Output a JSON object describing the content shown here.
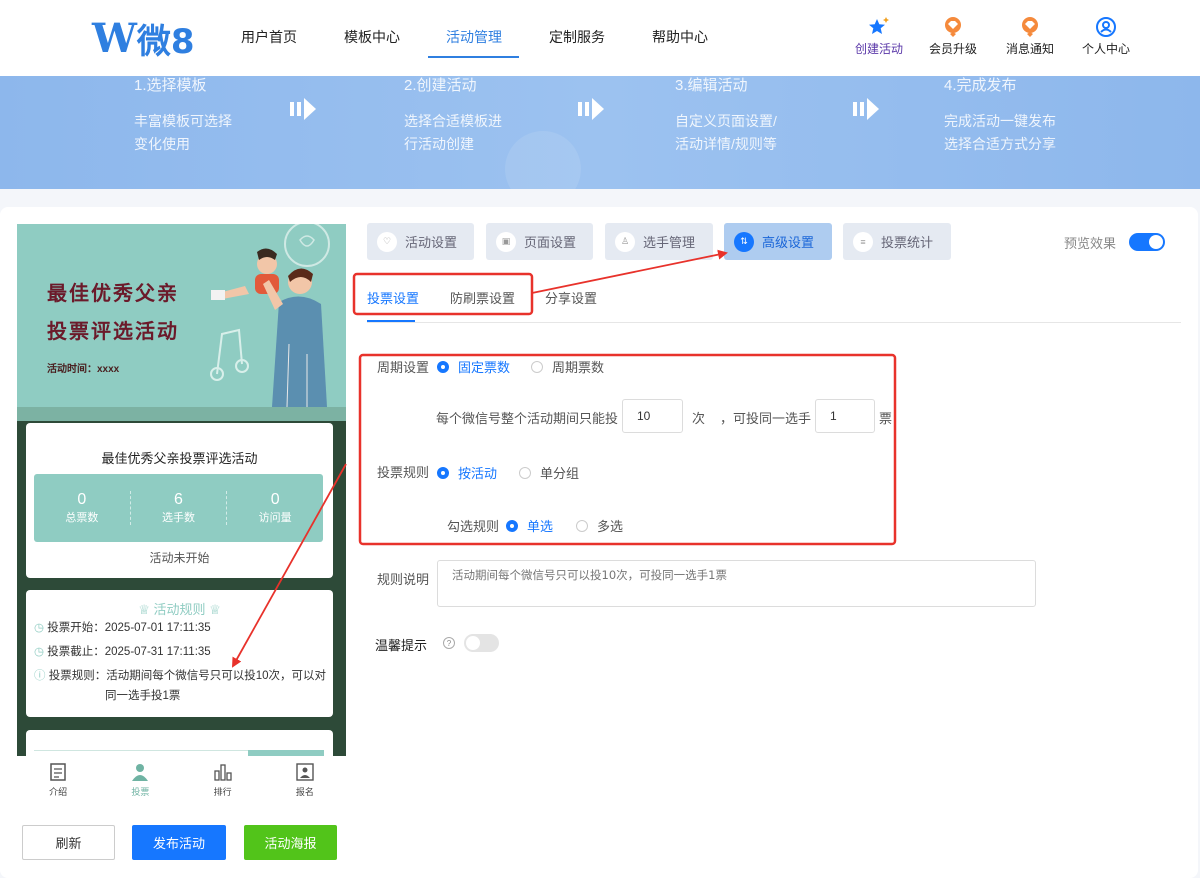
{
  "nav": {
    "logo_w": "W",
    "logo_text": "微8",
    "links": [
      "用户首页",
      "模板中心",
      "活动管理",
      "定制服务",
      "帮助中心"
    ],
    "active_link": "活动管理",
    "icons": [
      {
        "label": "创建活动",
        "icon": "star-sparkle-icon"
      },
      {
        "label": "会员升级",
        "icon": "diamond-badge-icon"
      },
      {
        "label": "消息通知",
        "icon": "diamond-badge-icon"
      },
      {
        "label": "个人中心",
        "icon": "user-circle-icon"
      }
    ]
  },
  "banner": {
    "steps": [
      {
        "title": "1.选择模板",
        "desc1": "丰富模板可选择",
        "desc2": "变化使用"
      },
      {
        "title": "2.创建活动",
        "desc1": "选择合适模板进",
        "desc2": "行活动创建"
      },
      {
        "title": "3.编辑活动",
        "desc1": "自定义页面设置/",
        "desc2": "活动详情/规则等"
      },
      {
        "title": "4.完成发布",
        "desc1": "完成活动一键发布",
        "desc2": "选择合适方式分享"
      }
    ]
  },
  "preview": {
    "poster_title1": "最佳优秀父亲",
    "poster_title2": "投票评选活动",
    "poster_time": "活动时间：xxxx",
    "card_title": "最佳优秀父亲投票评选活动",
    "stats": [
      {
        "value": "0",
        "label": "总票数"
      },
      {
        "value": "6",
        "label": "选手数"
      },
      {
        "value": "0",
        "label": "访问量"
      }
    ],
    "status": "活动未开始",
    "rules_heading": "活动规则",
    "vote_start": "投票开始：2025-07-01 17:11:35",
    "vote_end": "投票截止：2025-07-31 17:11:35",
    "vote_rule_1": "投票规则：活动期间每个微信号只可以投10次，可以对",
    "vote_rule_2": "同一选手投1票",
    "tabs": [
      {
        "label": "介绍",
        "icon": "document-icon"
      },
      {
        "label": "投票",
        "icon": "person-icon"
      },
      {
        "label": "排行",
        "icon": "bar-chart-icon"
      },
      {
        "label": "报名",
        "icon": "id-card-icon"
      }
    ],
    "active_tab": "投票"
  },
  "actions": {
    "refresh": "刷新",
    "publish": "发布活动",
    "poster": "活动海报"
  },
  "settings": {
    "tabs": [
      "活动设置",
      "页面设置",
      "选手管理",
      "高级设置",
      "投票统计"
    ],
    "active_tab": "高级设置",
    "preview_label": "预览效果",
    "preview_enabled": true,
    "subtabs": [
      "投票设置",
      "防刷票设置",
      "分享设置"
    ],
    "active_subtab": "投票设置",
    "period_label": "周期设置",
    "period_options": [
      "固定票数",
      "周期票数"
    ],
    "period_selected": "固定票数",
    "limit_prefix": "每个微信号整个活动期间只能投",
    "limit_value": "10",
    "limit_unit": "次",
    "same_prefix": "，可投同一选手",
    "same_value": "1",
    "same_unit": "票",
    "rule_label": "投票规则",
    "rule_options": [
      "按活动",
      "单分组"
    ],
    "rule_selected": "按活动",
    "check_label": "勾选规则",
    "check_options": [
      "单选",
      "多选"
    ],
    "check_selected": "单选",
    "desc_label": "规则说明",
    "desc_placeholder": "活动期间每个微信号只可以投10次，可投同一选手1票",
    "tip_label": "温馨提示",
    "tip_help": "?",
    "tip_enabled": false
  },
  "colors": {
    "accent": "#1677ff",
    "highlight": "#e8322b",
    "theme": "#8fccc2",
    "success": "#52c41a"
  }
}
